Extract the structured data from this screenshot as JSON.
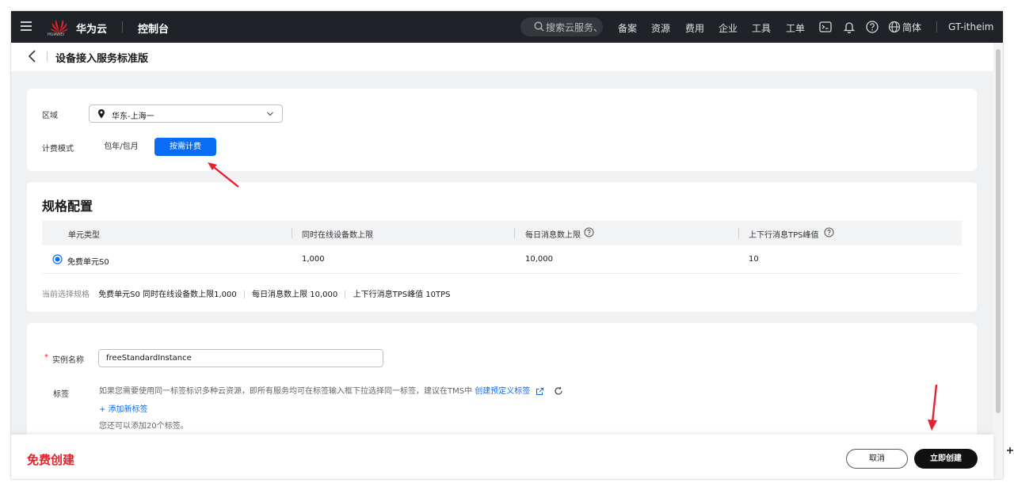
{
  "topbar": {
    "brand": "华为云",
    "logo_sub": "HUAWEI",
    "console": "控制台",
    "search_placeholder": "搜索云服务、",
    "nav": [
      "备案",
      "资源",
      "费用",
      "企业",
      "工具",
      "工单"
    ],
    "language": "简体",
    "user": "GT-itheim"
  },
  "header": {
    "title": "设备接入服务标准版"
  },
  "region_card": {
    "region_label": "区域",
    "region_value": "华东-上海一",
    "billing_label": "计费模式",
    "billing_options": [
      "包年/包月",
      "按需计费"
    ],
    "billing_selected": "按需计费"
  },
  "spec_card": {
    "title": "规格配置",
    "columns": [
      "单元类型",
      "同时在线设备数上限",
      "每日消息数上限",
      "上下行消息TPS峰值"
    ],
    "rows": [
      {
        "unit": "免费单元S0",
        "devices": "1,000",
        "messages": "10,000",
        "tps": "10",
        "selected": true
      }
    ],
    "current_label": "当前选择规格",
    "current_items": [
      "免费单元S0  同时在线设备数上限1,000",
      "每日消息数上限 10,000",
      "上下行消息TPS峰值 10TPS"
    ]
  },
  "instance_card": {
    "name_label": "实例名称",
    "required_mark": "*",
    "name_value": "freeStandardInstance",
    "tag_label": "标签",
    "tag_hint": "如果您需要使用同一标签标识多种云资源，即所有服务均可在标签输入框下拉选择同一标签，建议在TMS中",
    "tag_link": "创建预定义标签",
    "add_tag": "+ 添加新标签",
    "tag_remaining": "您还可以添加20个标签。"
  },
  "footer": {
    "title": "免费创建",
    "cancel": "取消",
    "create": "立即创建"
  },
  "colors": {
    "accent": "#0a6cf5",
    "danger": "#e5212a",
    "topbar": "#1f2226",
    "primary_button": "#111111"
  },
  "icons": [
    "menu-icon",
    "huawei-logo",
    "search-icon",
    "terminal-icon",
    "bell-icon",
    "help-icon",
    "globe-icon",
    "back-icon",
    "location-pin-icon",
    "chevron-down-icon",
    "radio-icon",
    "external-link-icon",
    "refresh-icon",
    "arrow-annotation"
  ]
}
